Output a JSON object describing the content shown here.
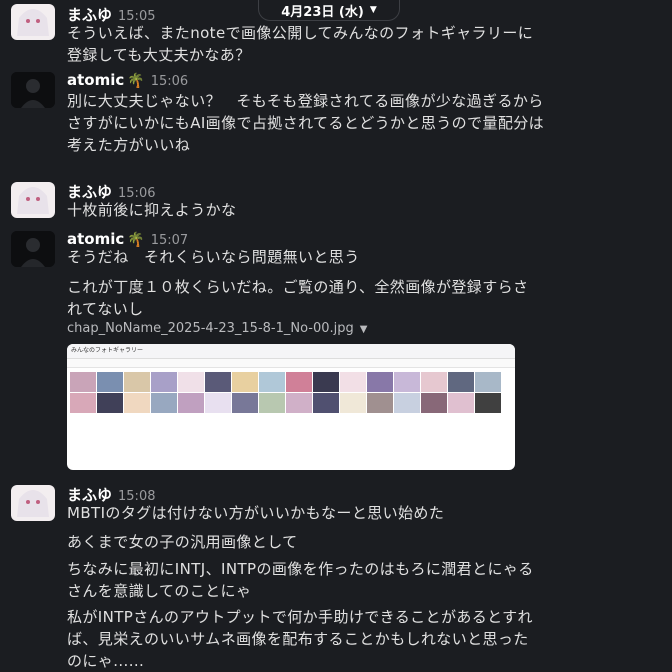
{
  "date_divider": {
    "label": "4月23日 (水)",
    "chevron": "chevron-down-icon"
  },
  "messages": [
    {
      "author": "まふゆ",
      "time": "15:05",
      "lines": [
        "そういえば、またnoteで画像公開してみんなのフォトギャラリーに",
        "登録しても大丈夫かなあ？"
      ]
    },
    {
      "author": "atomic",
      "emoji": "🌴",
      "time": "15:06",
      "lines": [
        "別に大丈夫じゃない？　そもそも登録されてる画像が少な過ぎるから",
        "さすがにいかにもAI画像で占拠されてるとどうかと思うので量配分は",
        "考えた方がいいね"
      ]
    },
    {
      "author": "まふゆ",
      "time": "15:06",
      "lines": [
        "十枚前後に抑えようかな"
      ]
    },
    {
      "author": "atomic",
      "emoji": "🌴",
      "time": "15:07",
      "lines": [
        "そうだね　それくらいなら問題無いと思う",
        "これが丁度１０枚くらいだね。ご覧の通り、全然画像が登録すらさ",
        "れてないし"
      ]
    },
    {
      "author": "まふゆ",
      "time": "15:08",
      "lines": [
        "MBTIのタグは付けない方がいいかもなーと思い始めた",
        "あくまで女の子の汎用画像として",
        "ちなみに最初にINTJ、INTPの画像を作ったのはもろに潤君とにゃる",
        "さんを意識してのことにゃ",
        "私がINTPさんのアウトプットで何か手助けできることがあるとすれ",
        "ば、見栄えのいいサムネ画像を配布することかもしれないと思った",
        "のにゃ......"
      ]
    }
  ],
  "attachment": {
    "filename": "chap_NoName_2025-4-23_15-8-1_No-00.jpg",
    "caret_icon": "caret-down-icon",
    "preview_title": "みんなのフォトギャラリー",
    "tile_colors": [
      "#c9a4b8",
      "#7a8fb0",
      "#d9c7a8",
      "#a8a0c8",
      "#f0e0e8",
      "#5a5a78",
      "#e8d0a0",
      "#b0c8d8",
      "#d08098",
      "#3a3a50",
      "#f2dfe6",
      "#8878a8",
      "#c8b8d8",
      "#e6c8d0",
      "#606880",
      "#a8b8c8",
      "#d8a8b8",
      "#404058",
      "#f0d8c0",
      "#98a8c0",
      "#c0a0c0",
      "#e8e0f0",
      "#787898",
      "#b8c8b0",
      "#d0b0c8",
      "#505070",
      "#f0e8d8",
      "#a09090",
      "#c8d0e0",
      "#886878",
      "#e0c0d0",
      "#404040"
    ]
  }
}
